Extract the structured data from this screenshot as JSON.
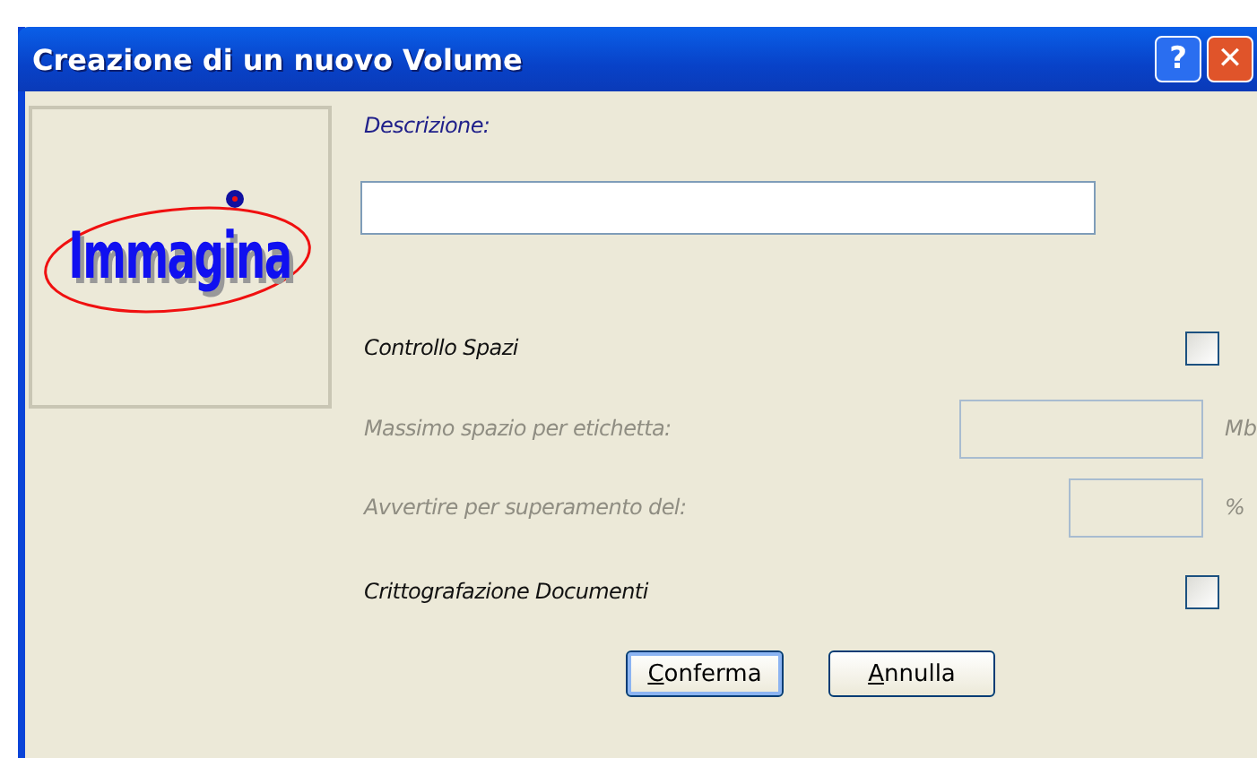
{
  "window": {
    "title": "Creazione di un nuovo Volume",
    "buttons": [
      {
        "kind": "help",
        "label": "?"
      },
      {
        "kind": "close",
        "label": "✕"
      }
    ]
  },
  "logo": {
    "text": "Immagina"
  },
  "description": {
    "label": "Descrizione:"
  },
  "options": [
    {
      "kind": "checkbox",
      "label": "Controllo Spazi",
      "checked": false,
      "disabled": false
    },
    {
      "kind": "wide_field",
      "label": "Massimo spazio per etichetta:",
      "unit": "Mb",
      "disabled": true
    },
    {
      "kind": "narrow_field",
      "label": "Avvertire per superamento del:",
      "unit": "%",
      "disabled": true
    },
    {
      "kind": "checkbox",
      "label": "Crittografazione Documenti",
      "checked": false,
      "disabled": false
    }
  ],
  "buttons": [
    {
      "label": "Conferma",
      "default": true
    },
    {
      "label": "Annulla",
      "default": false
    }
  ]
}
